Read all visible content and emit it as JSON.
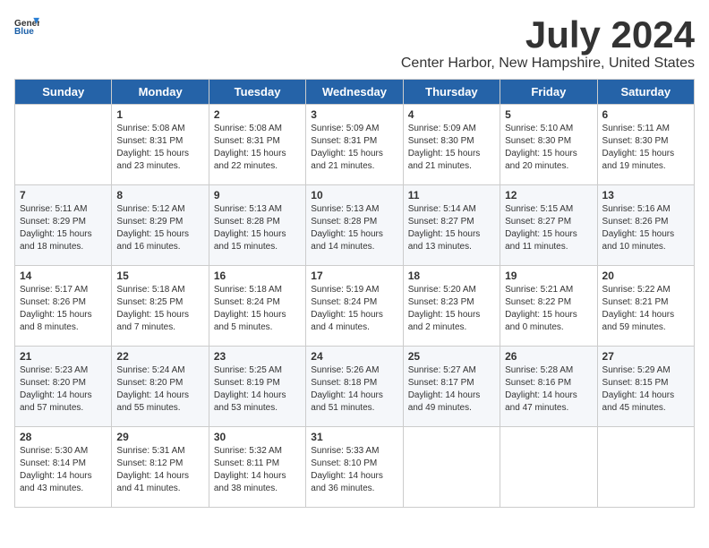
{
  "header": {
    "logo_general": "General",
    "logo_blue": "Blue",
    "month_title": "July 2024",
    "location": "Center Harbor, New Hampshire, United States"
  },
  "weekdays": [
    "Sunday",
    "Monday",
    "Tuesday",
    "Wednesday",
    "Thursday",
    "Friday",
    "Saturday"
  ],
  "weeks": [
    [
      {
        "day": "",
        "info": ""
      },
      {
        "day": "1",
        "info": "Sunrise: 5:08 AM\nSunset: 8:31 PM\nDaylight: 15 hours\nand 23 minutes."
      },
      {
        "day": "2",
        "info": "Sunrise: 5:08 AM\nSunset: 8:31 PM\nDaylight: 15 hours\nand 22 minutes."
      },
      {
        "day": "3",
        "info": "Sunrise: 5:09 AM\nSunset: 8:31 PM\nDaylight: 15 hours\nand 21 minutes."
      },
      {
        "day": "4",
        "info": "Sunrise: 5:09 AM\nSunset: 8:30 PM\nDaylight: 15 hours\nand 21 minutes."
      },
      {
        "day": "5",
        "info": "Sunrise: 5:10 AM\nSunset: 8:30 PM\nDaylight: 15 hours\nand 20 minutes."
      },
      {
        "day": "6",
        "info": "Sunrise: 5:11 AM\nSunset: 8:30 PM\nDaylight: 15 hours\nand 19 minutes."
      }
    ],
    [
      {
        "day": "7",
        "info": "Sunrise: 5:11 AM\nSunset: 8:29 PM\nDaylight: 15 hours\nand 18 minutes."
      },
      {
        "day": "8",
        "info": "Sunrise: 5:12 AM\nSunset: 8:29 PM\nDaylight: 15 hours\nand 16 minutes."
      },
      {
        "day": "9",
        "info": "Sunrise: 5:13 AM\nSunset: 8:28 PM\nDaylight: 15 hours\nand 15 minutes."
      },
      {
        "day": "10",
        "info": "Sunrise: 5:13 AM\nSunset: 8:28 PM\nDaylight: 15 hours\nand 14 minutes."
      },
      {
        "day": "11",
        "info": "Sunrise: 5:14 AM\nSunset: 8:27 PM\nDaylight: 15 hours\nand 13 minutes."
      },
      {
        "day": "12",
        "info": "Sunrise: 5:15 AM\nSunset: 8:27 PM\nDaylight: 15 hours\nand 11 minutes."
      },
      {
        "day": "13",
        "info": "Sunrise: 5:16 AM\nSunset: 8:26 PM\nDaylight: 15 hours\nand 10 minutes."
      }
    ],
    [
      {
        "day": "14",
        "info": "Sunrise: 5:17 AM\nSunset: 8:26 PM\nDaylight: 15 hours\nand 8 minutes."
      },
      {
        "day": "15",
        "info": "Sunrise: 5:18 AM\nSunset: 8:25 PM\nDaylight: 15 hours\nand 7 minutes."
      },
      {
        "day": "16",
        "info": "Sunrise: 5:18 AM\nSunset: 8:24 PM\nDaylight: 15 hours\nand 5 minutes."
      },
      {
        "day": "17",
        "info": "Sunrise: 5:19 AM\nSunset: 8:24 PM\nDaylight: 15 hours\nand 4 minutes."
      },
      {
        "day": "18",
        "info": "Sunrise: 5:20 AM\nSunset: 8:23 PM\nDaylight: 15 hours\nand 2 minutes."
      },
      {
        "day": "19",
        "info": "Sunrise: 5:21 AM\nSunset: 8:22 PM\nDaylight: 15 hours\nand 0 minutes."
      },
      {
        "day": "20",
        "info": "Sunrise: 5:22 AM\nSunset: 8:21 PM\nDaylight: 14 hours\nand 59 minutes."
      }
    ],
    [
      {
        "day": "21",
        "info": "Sunrise: 5:23 AM\nSunset: 8:20 PM\nDaylight: 14 hours\nand 57 minutes."
      },
      {
        "day": "22",
        "info": "Sunrise: 5:24 AM\nSunset: 8:20 PM\nDaylight: 14 hours\nand 55 minutes."
      },
      {
        "day": "23",
        "info": "Sunrise: 5:25 AM\nSunset: 8:19 PM\nDaylight: 14 hours\nand 53 minutes."
      },
      {
        "day": "24",
        "info": "Sunrise: 5:26 AM\nSunset: 8:18 PM\nDaylight: 14 hours\nand 51 minutes."
      },
      {
        "day": "25",
        "info": "Sunrise: 5:27 AM\nSunset: 8:17 PM\nDaylight: 14 hours\nand 49 minutes."
      },
      {
        "day": "26",
        "info": "Sunrise: 5:28 AM\nSunset: 8:16 PM\nDaylight: 14 hours\nand 47 minutes."
      },
      {
        "day": "27",
        "info": "Sunrise: 5:29 AM\nSunset: 8:15 PM\nDaylight: 14 hours\nand 45 minutes."
      }
    ],
    [
      {
        "day": "28",
        "info": "Sunrise: 5:30 AM\nSunset: 8:14 PM\nDaylight: 14 hours\nand 43 minutes."
      },
      {
        "day": "29",
        "info": "Sunrise: 5:31 AM\nSunset: 8:12 PM\nDaylight: 14 hours\nand 41 minutes."
      },
      {
        "day": "30",
        "info": "Sunrise: 5:32 AM\nSunset: 8:11 PM\nDaylight: 14 hours\nand 38 minutes."
      },
      {
        "day": "31",
        "info": "Sunrise: 5:33 AM\nSunset: 8:10 PM\nDaylight: 14 hours\nand 36 minutes."
      },
      {
        "day": "",
        "info": ""
      },
      {
        "day": "",
        "info": ""
      },
      {
        "day": "",
        "info": ""
      }
    ]
  ]
}
